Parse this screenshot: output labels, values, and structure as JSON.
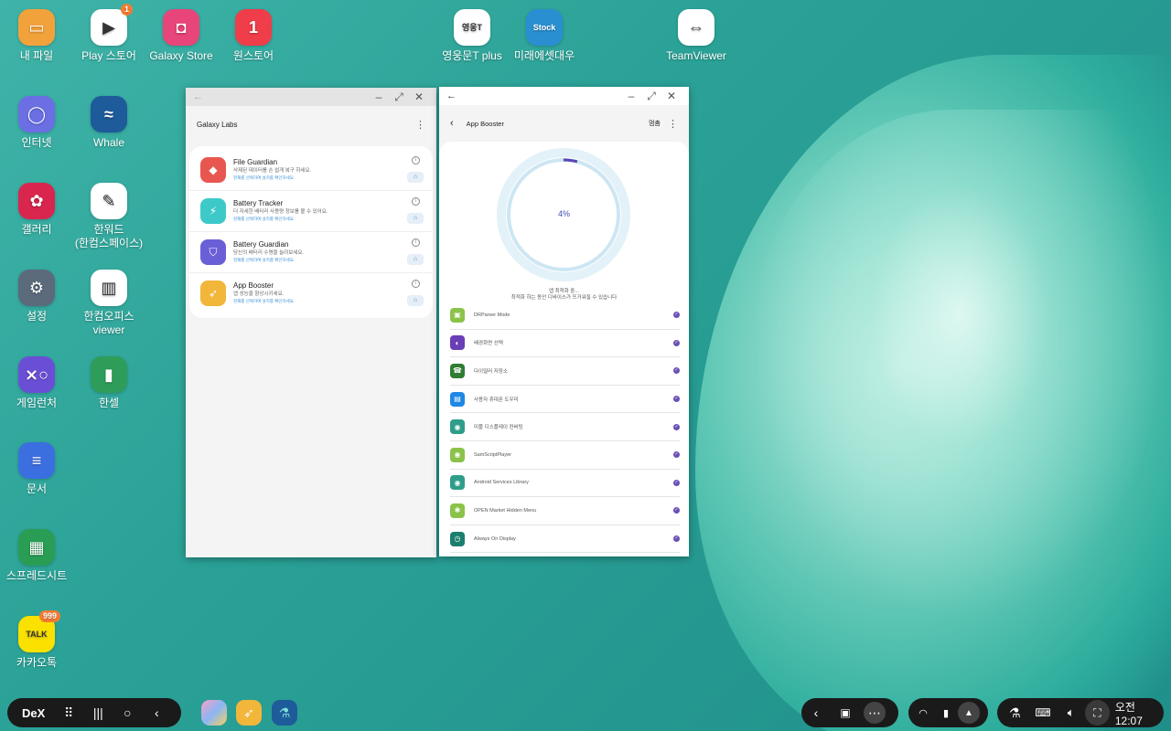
{
  "desktop": {
    "icons": [
      {
        "label": "내 파일",
        "color": "#f2a23a",
        "glyph": "▭"
      },
      {
        "label": "Play 스토어",
        "color": "#ffffff",
        "glyph": "▶",
        "badge": "1"
      },
      {
        "label": "Galaxy Store",
        "color": "#e8457a",
        "glyph": "◘"
      },
      {
        "label": "원스토어",
        "color": "#ef3e4a",
        "glyph": "1"
      },
      {
        "label": "영웅문T plus",
        "color": "#ffffff",
        "glyph": "영웅T"
      },
      {
        "label": "미래에셋대우",
        "color": "#2a8fd1",
        "glyph": "Stock"
      },
      {
        "label": "TeamViewer",
        "color": "#ffffff",
        "glyph": "⇔"
      },
      {
        "label": "인터넷",
        "color": "#6b6fe3",
        "glyph": "◯"
      },
      {
        "label": "Whale",
        "color": "#1e5b9a",
        "glyph": "≈"
      },
      {
        "label": "갤러리",
        "color": "#d9264f",
        "glyph": "✿"
      },
      {
        "label": "한워드\n(한컴스페이스)",
        "color": "#ffffff",
        "glyph": "✎"
      },
      {
        "label": "설정",
        "color": "#5b6b7c",
        "glyph": "⚙"
      },
      {
        "label": "한컴오피스\nviewer",
        "color": "#ffffff",
        "glyph": "▥"
      },
      {
        "label": "게임런처",
        "color": "#6a4fd6",
        "glyph": "⨯○"
      },
      {
        "label": "한셀",
        "color": "#2e9d5a",
        "glyph": "▮"
      },
      {
        "label": "문서",
        "color": "#3b6fe0",
        "glyph": "≡"
      },
      {
        "label": "스프레드시트",
        "color": "#2a9d55",
        "glyph": "▦"
      },
      {
        "label": "카카오톡",
        "color": "#fae100",
        "glyph": "TALK",
        "badge": "999"
      }
    ]
  },
  "galaxy_labs": {
    "title": "Galaxy Labs",
    "items": [
      {
        "title": "File Guardian",
        "desc": "삭제된 데이터를 손 쉽게 복구 하세요.",
        "link": "현재를 선택하여 설치를 확인하세요.",
        "color": "#e8574f",
        "glyph": "◆"
      },
      {
        "title": "Battery Tracker",
        "desc": "더 자세한 배터리 사용량 정보를 볼 수 있어요.",
        "link": "현재를 선택하여 설치를 확인하세요.",
        "color": "#3ec9c9",
        "glyph": "⚡"
      },
      {
        "title": "Battery Guardian",
        "desc": "당신의 배터리 수명을 늘려보세요.",
        "link": "현재를 선택하여 설치를 확인하세요.",
        "color": "#6a5fd6",
        "glyph": "⛉"
      },
      {
        "title": "App Booster",
        "desc": "앱 성능을 향상시키세요.",
        "link": "현재를 선택하여 설치를 확인하세요.",
        "color": "#f2b63a",
        "glyph": "➶"
      }
    ]
  },
  "app_booster": {
    "title": "App Booster",
    "stop_label": "멈춤",
    "progress": "4%",
    "progress_fraction": 0.04,
    "status": "앱 최적화 중...",
    "substatus": "최적화 하는 동안 디바이스가 뜨거워질 수 있습니다",
    "apps": [
      {
        "name": "DRParser Mode",
        "color": "#8bc34a",
        "glyph": "▣"
      },
      {
        "name": "배경화면 선택",
        "color": "#6a3fb5",
        "glyph": "◐"
      },
      {
        "name": "다이얼러 저장소",
        "color": "#2e7d32",
        "glyph": "☎"
      },
      {
        "name": "사용자 휴대폰 도우미",
        "color": "#1e88e5",
        "glyph": "▤"
      },
      {
        "name": "미플 디스플레이 컨버팅",
        "color": "#2e9d8a",
        "glyph": "◉"
      },
      {
        "name": "SamScriptPlayer",
        "color": "#8bc34a",
        "glyph": "◉"
      },
      {
        "name": "Android Services Library",
        "color": "#2e9d8a",
        "glyph": "◉"
      },
      {
        "name": "OPEN Market Hidden Menu",
        "color": "#8bc34a",
        "glyph": "✱"
      },
      {
        "name": "Always On Display",
        "color": "#1b7f6e",
        "glyph": "◷"
      }
    ]
  },
  "taskbar": {
    "dex_label": "DeX",
    "time": "오전 12:07"
  }
}
